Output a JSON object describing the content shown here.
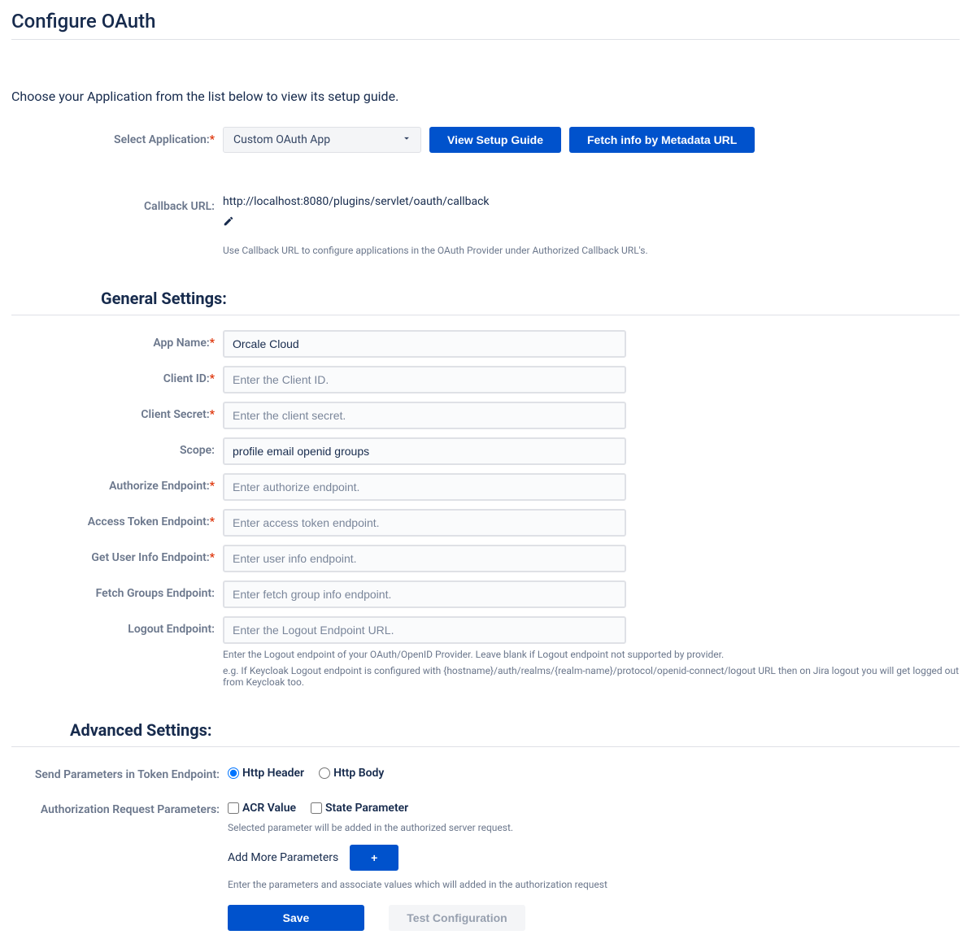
{
  "title": "Configure OAuth",
  "intro": "Choose your Application from the list below to view its setup guide.",
  "select_app": {
    "label": "Select Application:",
    "value": "Custom OAuth App",
    "view_guide_btn": "View Setup Guide",
    "fetch_meta_btn": "Fetch info by Metadata URL"
  },
  "callback": {
    "label": "Callback URL:",
    "value": "http://localhost:8080/plugins/servlet/oauth/callback",
    "hint": "Use Callback URL to configure applications in the OAuth Provider under Authorized Callback URL's."
  },
  "general": {
    "heading": "General Settings:",
    "app_name": {
      "label": "App Name:",
      "value": "Orcale Cloud"
    },
    "client_id": {
      "label": "Client ID:",
      "placeholder": "Enter the Client ID."
    },
    "client_secret": {
      "label": "Client Secret:",
      "placeholder": "Enter the client secret."
    },
    "scope": {
      "label": "Scope:",
      "value": "profile email openid groups"
    },
    "authorize_ep": {
      "label": "Authorize Endpoint:",
      "placeholder": "Enter authorize endpoint."
    },
    "access_token_ep": {
      "label": "Access Token Endpoint:",
      "placeholder": "Enter access token endpoint."
    },
    "userinfo_ep": {
      "label": "Get User Info Endpoint:",
      "placeholder": "Enter user info endpoint."
    },
    "fetch_groups_ep": {
      "label": "Fetch Groups Endpoint:",
      "placeholder": "Enter fetch group info endpoint."
    },
    "logout_ep": {
      "label": "Logout Endpoint:",
      "placeholder": "Enter the Logout Endpoint URL."
    },
    "logout_hint1": "Enter the Logout endpoint of your OAuth/OpenID Provider. Leave blank if Logout endpoint not supported by provider.",
    "logout_hint2": "e.g. If Keycloak Logout endpoint is configured with {hostname}/auth/realms/{realm-name}/protocol/openid-connect/logout URL then on Jira logout you will get logged out from Keycloak too."
  },
  "advanced": {
    "heading": "Advanced Settings:",
    "send_params_label": "Send Parameters in Token Endpoint:",
    "http_header": "Http Header",
    "http_body": "Http Body",
    "auth_req_params_label": "Authorization Request Parameters:",
    "acr_value": "ACR Value",
    "state_param": "State Parameter",
    "auth_req_hint": "Selected parameter will be added in the authorized server request.",
    "add_more_label": "Add More Parameters",
    "add_more_hint": "Enter the parameters and associate values which will added in the authorization request",
    "save_btn": "Save",
    "test_btn": "Test Configuration"
  }
}
